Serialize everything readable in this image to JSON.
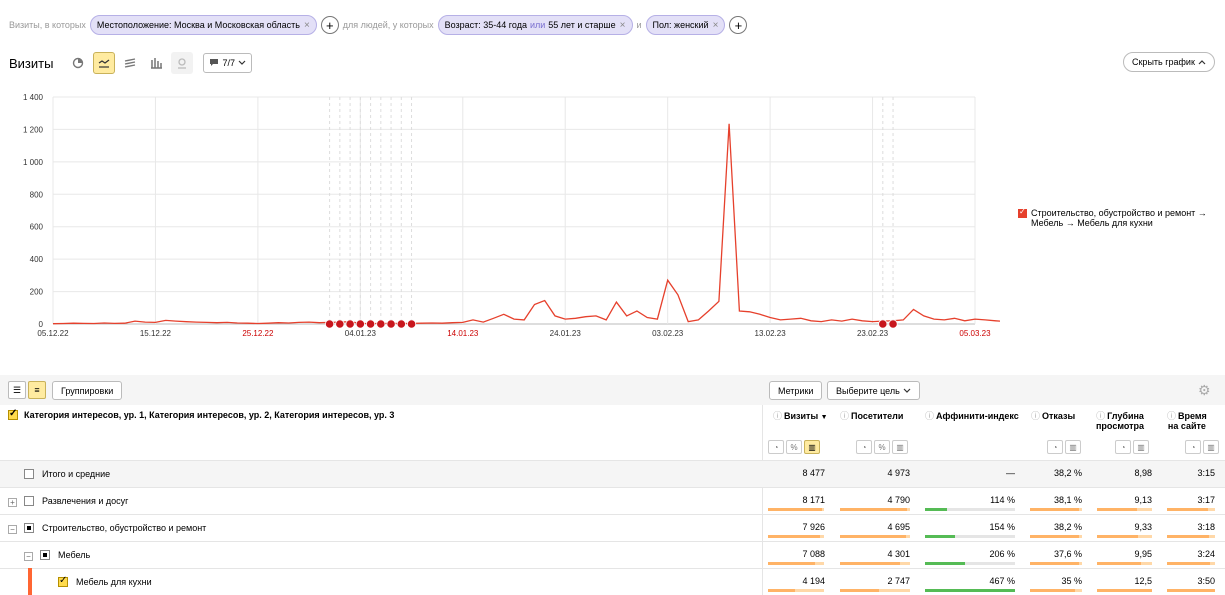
{
  "filters": {
    "prefix": "Визиты, в которых",
    "location_chip": "Местоположение: Москва и Московская область",
    "middle": "для людей, у которых",
    "age_chip_a": "Возраст: 35-44 года",
    "age_chip_or": "или",
    "age_chip_b": "55 лет и старше",
    "and": "и",
    "gender_chip": "Пол: женский"
  },
  "chart_header": {
    "title": "Визиты",
    "notes": "7/7",
    "hide_button": "Скрыть график"
  },
  "chart_data": {
    "type": "line",
    "y_ticks": [
      "0",
      "200",
      "400",
      "600",
      "800",
      "1 000",
      "1 200",
      "1 400"
    ],
    "ylim": [
      0,
      1400
    ],
    "x_ticks": [
      {
        "label": "05.12.22",
        "day": 0,
        "weekend": false
      },
      {
        "label": "15.12.22",
        "day": 10,
        "weekend": false
      },
      {
        "label": "25.12.22",
        "day": 20,
        "weekend": true
      },
      {
        "label": "04.01.23",
        "day": 30,
        "weekend": false
      },
      {
        "label": "14.01.23",
        "day": 40,
        "weekend": true
      },
      {
        "label": "24.01.23",
        "day": 50,
        "weekend": false
      },
      {
        "label": "03.02.23",
        "day": 60,
        "weekend": false
      },
      {
        "label": "13.02.23",
        "day": 70,
        "weekend": false
      },
      {
        "label": "23.02.23",
        "day": 80,
        "weekend": false
      },
      {
        "label": "05.03.23",
        "day": 90,
        "weekend": true
      }
    ],
    "series": [
      {
        "name": "Строительство, обустройство и ремонт → Мебель → Мебель для кухни",
        "color": "#e6402c",
        "values": [
          2,
          3,
          5,
          4,
          3,
          6,
          4,
          5,
          18,
          12,
          10,
          22,
          18,
          14,
          12,
          10,
          8,
          10,
          6,
          5,
          3,
          5,
          8,
          6,
          10,
          12,
          8,
          10,
          12,
          14,
          4,
          3,
          3,
          4,
          3,
          4,
          5,
          6,
          5,
          8,
          10,
          25,
          12,
          35,
          60,
          30,
          25,
          120,
          145,
          50,
          30,
          35,
          45,
          50,
          25,
          135,
          50,
          80,
          40,
          30,
          270,
          180,
          15,
          25,
          80,
          140,
          1235,
          80,
          75,
          60,
          40,
          25,
          30,
          35,
          20,
          15,
          25,
          18,
          30,
          20,
          15,
          18,
          20,
          25,
          90,
          50,
          30,
          25,
          35,
          20,
          30,
          25,
          20,
          15,
          20,
          35,
          25,
          55,
          30,
          20
        ]
      }
    ],
    "holiday_markers_days": [
      27,
      28,
      29,
      30,
      31,
      32,
      33,
      34,
      35,
      81,
      82
    ],
    "grid": true
  },
  "legend": {
    "label": "Строительство, обустройство и ремонт → Мебель → Мебель для кухни"
  },
  "toolbar": {
    "groupings": "Группировки",
    "metrics": "Метрики",
    "goal": "Выберите цель"
  },
  "table": {
    "dimension_header": "Категория интересов, ур. 1, Категория интересов, ур. 2, Категория интересов, ур. 3",
    "columns": [
      {
        "label": "Визиты",
        "sort": "▼"
      },
      {
        "label": "Посетители"
      },
      {
        "label": "Аффинити-индекс"
      },
      {
        "label": "Отказы"
      },
      {
        "label_line1": "Глубина",
        "label_line2": "просмотра"
      },
      {
        "label_line1": "Время",
        "label_line2": "на сайте"
      }
    ],
    "rows": [
      {
        "name": "Итого и средние",
        "visits": "8 477",
        "visitors": "4 973",
        "affinity": "—",
        "bounce": "38,2 %",
        "depth": "8,98",
        "time": "3:15"
      },
      {
        "name": "Развлечения и досуг",
        "visits": "8 171",
        "visitors": "4 790",
        "affinity": "114 %",
        "bounce": "38,1 %",
        "depth": "9,13",
        "time": "3:17",
        "visits_share": 0.96,
        "visitors_share": 0.96,
        "affinity_share": 0.24,
        "bounce_share": 0.95,
        "depth_share": 0.73,
        "time_share": 0.86
      },
      {
        "name": "Строительство, обустройство и ремонт",
        "visits": "7 926",
        "visitors": "4 695",
        "affinity": "154 %",
        "bounce": "38,2 %",
        "depth": "9,33",
        "time": "3:18",
        "visits_share": 0.93,
        "visitors_share": 0.94,
        "affinity_share": 0.33,
        "bounce_share": 0.95,
        "depth_share": 0.75,
        "time_share": 0.87
      },
      {
        "name": "Мебель",
        "visits": "7 088",
        "visitors": "4 301",
        "affinity": "206 %",
        "bounce": "37,6 %",
        "depth": "9,95",
        "time": "3:24",
        "visits_share": 0.84,
        "visitors_share": 0.86,
        "affinity_share": 0.44,
        "bounce_share": 0.94,
        "depth_share": 0.8,
        "time_share": 0.9
      },
      {
        "name": "Мебель для кухни",
        "visits": "4 194",
        "visitors": "2 747",
        "affinity": "467 %",
        "bounce": "35 %",
        "depth": "12,5",
        "time": "3:50",
        "visits_share": 0.49,
        "visitors_share": 0.55,
        "affinity_share": 1.0,
        "bounce_share": 0.87,
        "depth_share": 1.0,
        "time_share": 1.0
      }
    ]
  }
}
